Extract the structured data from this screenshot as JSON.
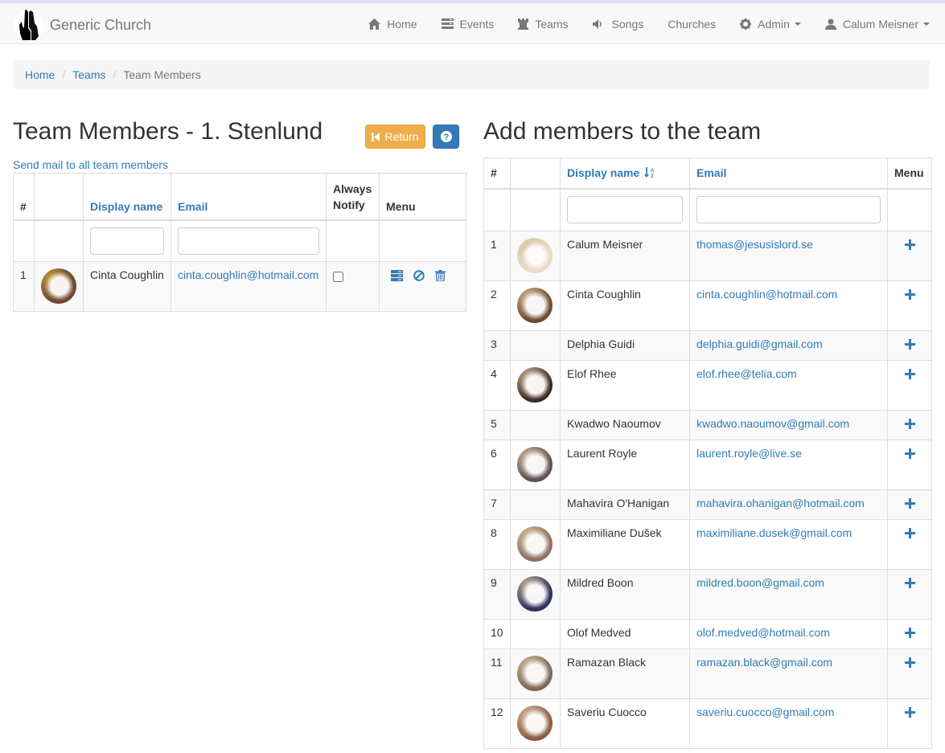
{
  "brand": {
    "name": "Generic Church",
    "logo": "praying-hands-icon"
  },
  "nav": [
    {
      "label": "Home",
      "icon": "home-icon"
    },
    {
      "label": "Events",
      "icon": "events-icon"
    },
    {
      "label": "Teams",
      "icon": "chess-rook-icon"
    },
    {
      "label": "Songs",
      "icon": "volume-icon"
    },
    {
      "label": "Churches",
      "icon": ""
    },
    {
      "label": "Admin",
      "icon": "gear-icon",
      "dropdown": true
    },
    {
      "label": "Calum Meisner",
      "icon": "user-icon",
      "dropdown": true
    }
  ],
  "breadcrumb": [
    "Home",
    "Teams",
    "Team Members"
  ],
  "left": {
    "title": "Team Members - 1. Stenlund",
    "return_label": "Return",
    "mail_link": "Send mail to all team members",
    "columns": {
      "num": "#",
      "name": "Display name",
      "email": "Email",
      "notify_line1": "Always",
      "notify_line2": "Notify",
      "menu": "Menu"
    },
    "rows": [
      {
        "num": "1",
        "name": "Cinta Coughlin",
        "email": "cinta.coughlin@hotmail.com",
        "always_notify": false,
        "avatar": "#6b4a2e"
      }
    ]
  },
  "right": {
    "title": "Add members to the team",
    "columns": {
      "num": "#",
      "name": "Display name",
      "email": "Email",
      "menu": "Menu"
    },
    "rows": [
      {
        "num": "1",
        "name": "Calum Meisner",
        "email": "thomas@jesusislord.se",
        "avatar": "#e8dcc8"
      },
      {
        "num": "2",
        "name": "Cinta Coughlin",
        "email": "cinta.coughlin@hotmail.com",
        "avatar": "#6b4a2e"
      },
      {
        "num": "3",
        "name": "Delphia Guidi",
        "email": "delphia.guidi@gmail.com",
        "avatar": ""
      },
      {
        "num": "4",
        "name": "Elof Rhee",
        "email": "elof.rhee@telia.com",
        "avatar": "#3a2a22"
      },
      {
        "num": "5",
        "name": "Kwadwo Naoumov",
        "email": "kwadwo.naoumov@gmail.com",
        "avatar": ""
      },
      {
        "num": "6",
        "name": "Laurent Royle",
        "email": "laurent.royle@live.se",
        "avatar": "#5a5250"
      },
      {
        "num": "7",
        "name": "Mahavira O'Hanigan",
        "email": "mahavira.ohanigan@hotmail.com",
        "avatar": ""
      },
      {
        "num": "8",
        "name": "Maximiliane Dušek",
        "email": "maximiliane.dusek@gmail.com",
        "avatar": "#8c7060"
      },
      {
        "num": "9",
        "name": "Mildred Boon",
        "email": "mildred.boon@gmail.com",
        "avatar": "#2c2f5a"
      },
      {
        "num": "10",
        "name": "Olof Medved",
        "email": "olof.medved@hotmail.com",
        "avatar": ""
      },
      {
        "num": "11",
        "name": "Ramazan Black",
        "email": "ramazan.black@gmail.com",
        "avatar": "#7a6656"
      },
      {
        "num": "12",
        "name": "Saveriu Cuocco",
        "email": "saveriu.cuocco@gmail.com",
        "avatar": "#8a5a40"
      }
    ]
  },
  "colors": {
    "link": "#337ab7",
    "warning": "#f0ad4e",
    "primary": "#337ab7"
  }
}
